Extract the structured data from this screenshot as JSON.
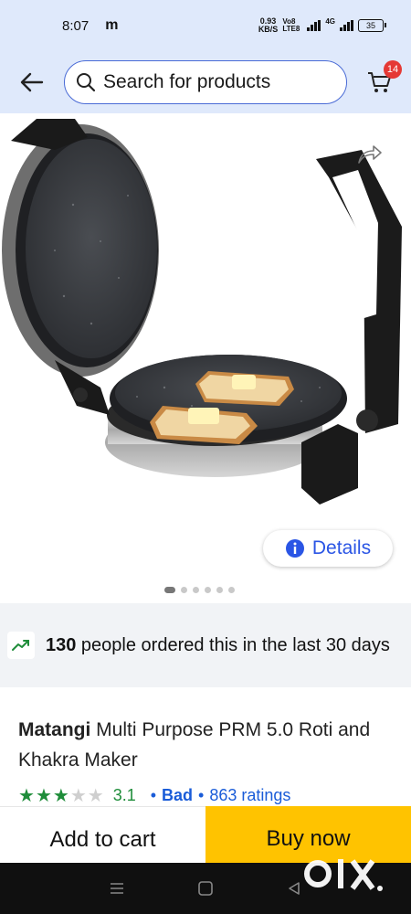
{
  "status_bar": {
    "time": "8:07",
    "app_indicator": "m",
    "speed_value": "0.93",
    "speed_unit": "KB/S",
    "network_label": "Vo8 LTE8",
    "network_type": "4G",
    "battery": "35"
  },
  "header": {
    "search_placeholder": "Search for products",
    "cart_count": "14",
    "icons": [
      "back-arrow-icon",
      "search-icon",
      "cart-icon"
    ]
  },
  "product_image": {
    "details_label": "Details",
    "slide_count": 6,
    "active_slide": 1
  },
  "orders_banner": {
    "count": "130",
    "text": " people ordered this in the last 30 days"
  },
  "product": {
    "brand": "Matangi",
    "name": " Multi Purpose PRM 5.0 Roti and Khakra Maker",
    "rating": "3.1",
    "rating_stars": 3.1,
    "rating_label": "Bad",
    "ratings_count": "863 ratings"
  },
  "actions": {
    "add_to_cart": "Add to cart",
    "buy_now": "Buy now"
  },
  "watermark": "OLX",
  "colors": {
    "header_bg": "#dfe9fb",
    "accent_blue": "#2a55e5",
    "buy_now_yellow": "#ffc300",
    "rating_green": "#1f8d3a",
    "badge_red": "#e53935"
  }
}
